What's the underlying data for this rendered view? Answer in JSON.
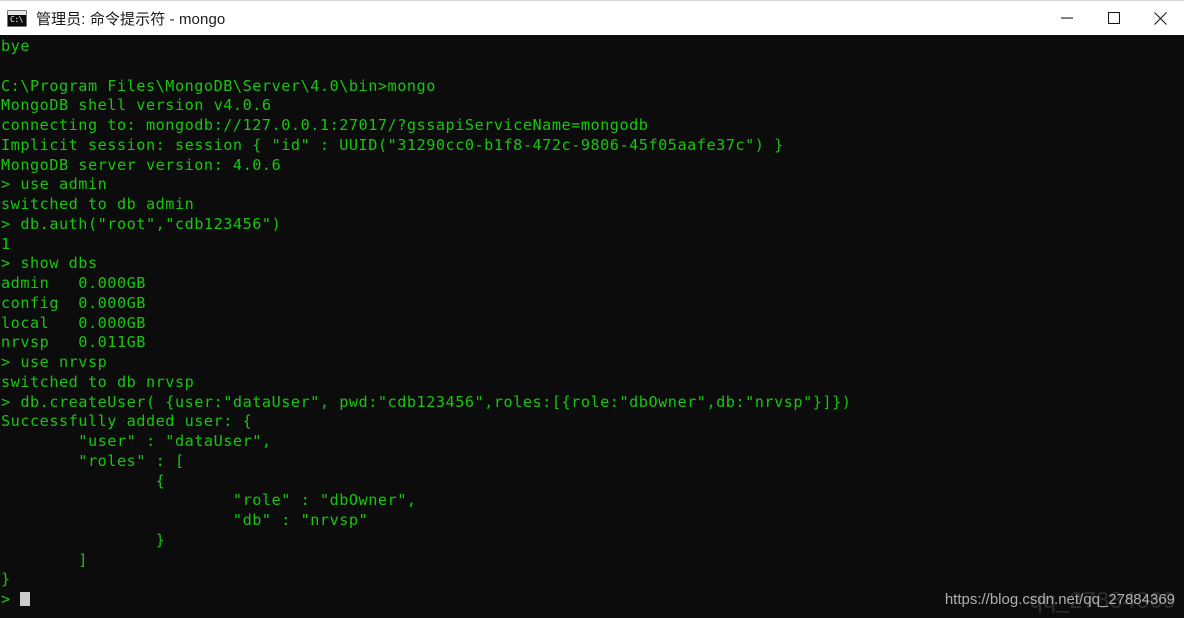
{
  "window": {
    "title": "管理员: 命令提示符 - mongo",
    "icon_name": "cmd-icon",
    "icon_glyph": "C:\\",
    "controls": {
      "minimize_label": "最小化",
      "maximize_label": "最大化",
      "close_label": "关闭"
    }
  },
  "terminal": {
    "background_color": "#0c0c0c",
    "text_color": "#16c60c",
    "cursor_color": "#cccccc",
    "lines": [
      "bye",
      "",
      "C:\\Program Files\\MongoDB\\Server\\4.0\\bin>mongo",
      "MongoDB shell version v4.0.6",
      "connecting to: mongodb://127.0.0.1:27017/?gssapiServiceName=mongodb",
      "Implicit session: session { \"id\" : UUID(\"31290cc0-b1f8-472c-9806-45f05aafe37c\") }",
      "MongoDB server version: 4.0.6",
      "> use admin",
      "switched to db admin",
      "> db.auth(\"root\",\"cdb123456\")",
      "1",
      "> show dbs",
      "admin   0.000GB",
      "config  0.000GB",
      "local   0.000GB",
      "nrvsp   0.011GB",
      "> use nrvsp",
      "switched to db nrvsp",
      "> db.createUser( {user:\"dataUser\", pwd:\"cdb123456\",roles:[{role:\"dbOwner\",db:\"nrvsp\"}]})",
      "Successfully added user: {",
      "        \"user\" : \"dataUser\",",
      "        \"roles\" : [",
      "                {",
      "                        \"role\" : \"dbOwner\",",
      "                        \"db\" : \"nrvsp\"",
      "                }",
      "        ]",
      "}",
      ">"
    ],
    "prompt_line_index": 28
  },
  "watermark": {
    "text": "https://blog.csdn.net/qq_27884369",
    "ghost_text": "qq_27884369"
  }
}
